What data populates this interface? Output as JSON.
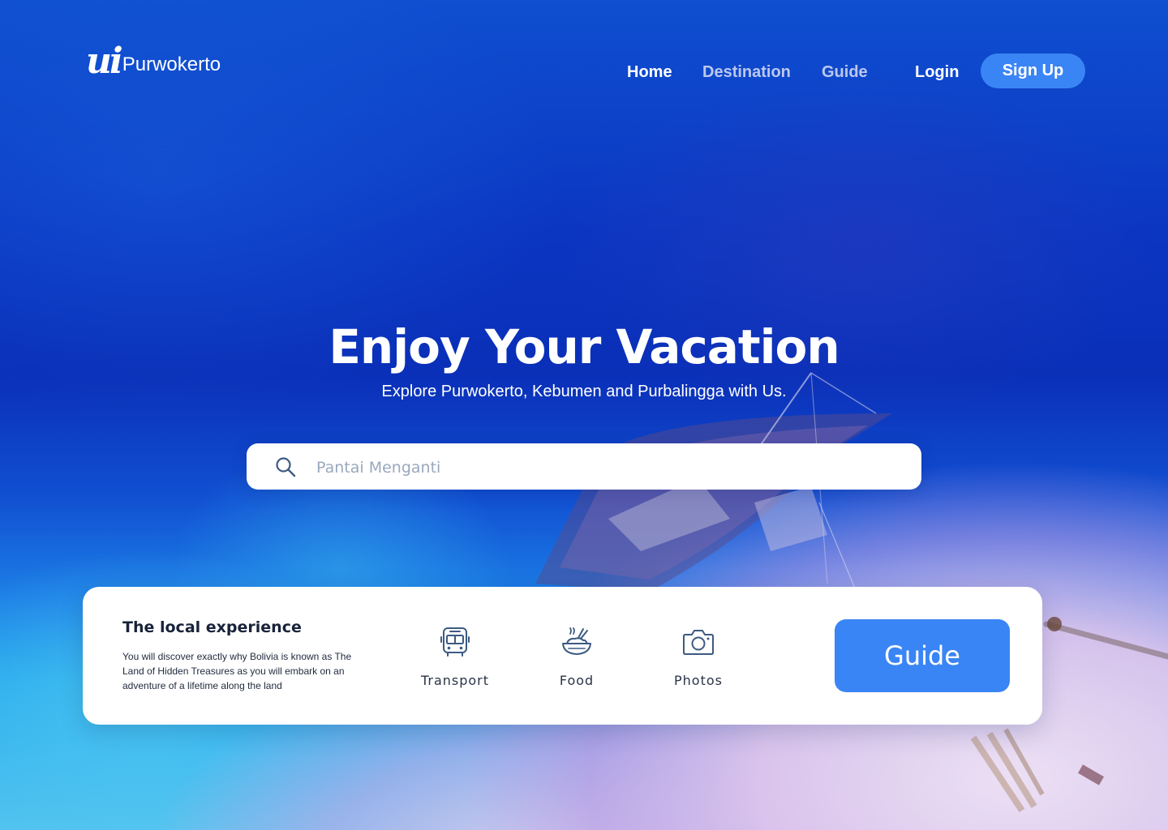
{
  "brand": {
    "mark": "ui",
    "name": "Purwokerto"
  },
  "nav": {
    "home": "Home",
    "destination": "Destination",
    "guide": "Guide",
    "login": "Login",
    "signup": "Sign Up"
  },
  "hero": {
    "title": "Enjoy Your Vacation",
    "subtitle": "Explore Purwokerto, Kebumen and Purbalingga with Us."
  },
  "search": {
    "placeholder": "Pantai Menganti",
    "icon": "search-icon"
  },
  "experience": {
    "title": "The local experience",
    "description": "You will discover exactly why Bolivia is known as The Land of Hidden Treasures as you will embark on an adventure of a lifetime along the land",
    "features": [
      {
        "label": "Transport",
        "icon": "bus-icon"
      },
      {
        "label": "Food",
        "icon": "food-bowl-icon"
      },
      {
        "label": "Photos",
        "icon": "camera-icon"
      }
    ],
    "guide_button": "Guide"
  },
  "colors": {
    "accent": "#3a85f5",
    "nav_inactive": "#bcc8ee",
    "text_dark": "#18233a",
    "icon": "#3d5a82"
  }
}
